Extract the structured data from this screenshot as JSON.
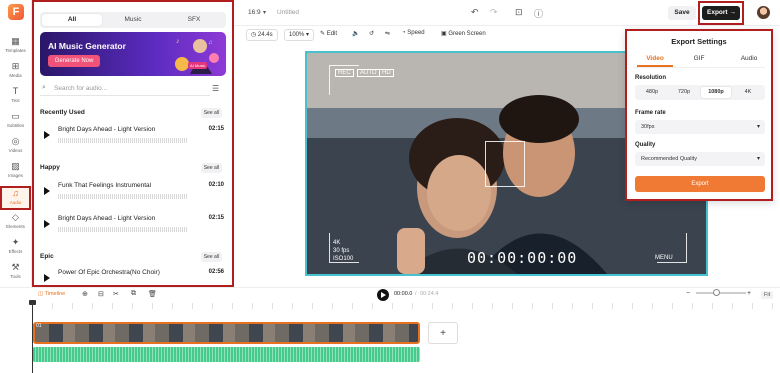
{
  "app": {
    "logo_letter": "F",
    "project_title": "Untitled"
  },
  "rail": {
    "items": [
      {
        "label": "Templates"
      },
      {
        "label": "Media"
      },
      {
        "label": "Text"
      },
      {
        "label": "Subtitles"
      },
      {
        "label": "Videos"
      },
      {
        "label": "Images"
      },
      {
        "label": "Audio"
      },
      {
        "label": "Elements"
      },
      {
        "label": "Effects"
      },
      {
        "label": "Tools"
      }
    ]
  },
  "audio_panel": {
    "tabs": [
      "All",
      "Music",
      "SFX"
    ],
    "banner": {
      "title": "AI Music Generator",
      "button": "Generate Now",
      "badge": "AI Music"
    },
    "search_placeholder": "Search for audio...",
    "see_all": "See all",
    "sections": [
      {
        "title": "Recently Used",
        "tracks": [
          {
            "name": "Bright Days Ahead - Light Version",
            "duration": "02:15"
          }
        ]
      },
      {
        "title": "Happy",
        "tracks": [
          {
            "name": "Funk That Feelings Instrumental",
            "duration": "02:10"
          },
          {
            "name": "Bright Days Ahead - Light Version",
            "duration": "02:15"
          }
        ]
      },
      {
        "title": "Epic",
        "tracks": [
          {
            "name": "Power Of Epic Orchestra(No Choir)",
            "duration": "02:56"
          }
        ]
      }
    ]
  },
  "topbar": {
    "aspect": "16:9",
    "save": "Save",
    "export": "Export"
  },
  "toolbar": {
    "duration": "24.4s",
    "zoom": "100%",
    "edit": "Edit",
    "speed": "Speed",
    "green_screen": "Green Screen"
  },
  "video_overlay": {
    "rec": "REC",
    "auto": "AUTO",
    "hd": "HD",
    "resolution": "4K",
    "fps": "30 fps",
    "iso": "ISO100",
    "timecode": "00:00:00:00",
    "menu": "MENU"
  },
  "export_settings": {
    "title": "Export Settings",
    "tabs": [
      "Video",
      "GIF",
      "Audio"
    ],
    "resolution_label": "Resolution",
    "resolutions": [
      "480p",
      "720p",
      "1080p",
      "4K"
    ],
    "selected_resolution": "1080p",
    "frame_rate_label": "Frame rate",
    "frame_rate": "30fps",
    "quality_label": "Quality",
    "quality": "Recommended Quality",
    "export_button": "Export"
  },
  "timeline": {
    "label": "Timeline",
    "current_time": "00:00.0",
    "total_time": "00:24.4",
    "fit": "Fit",
    "clip_index": "01",
    "add": "+"
  },
  "colors": {
    "accent": "#e8711f",
    "highlight_border": "#b01e1e",
    "video_border": "#49c2d0",
    "audio_track": "#46c98c"
  }
}
